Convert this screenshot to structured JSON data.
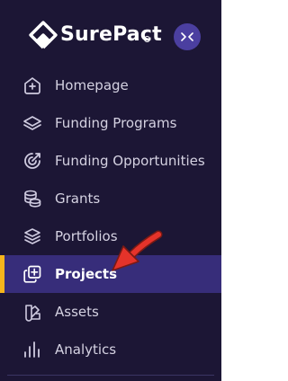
{
  "app": {
    "brand_name": "SurePact",
    "collapse_button_label": "><"
  },
  "colors": {
    "sidebar_bg": "#1c1635",
    "active_bg": "#372d7a",
    "active_marker": "#f6b51c",
    "collapse_bg": "#4b3fa0",
    "annotation_arrow": "#e5332a"
  },
  "nav": {
    "items": [
      {
        "label": "Homepage",
        "icon": "home-plus-icon"
      },
      {
        "label": "Funding Programs",
        "icon": "layers-icon"
      },
      {
        "label": "Funding Opportunities",
        "icon": "target-icon"
      },
      {
        "label": "Grants",
        "icon": "coin-stack-icon"
      },
      {
        "label": "Portfolios",
        "icon": "stacked-layers-icon"
      },
      {
        "label": "Projects",
        "icon": "copy-plus-icon",
        "active": true
      },
      {
        "label": "Assets",
        "icon": "shapes-icon"
      },
      {
        "label": "Analytics",
        "icon": "bar-chart-icon"
      }
    ]
  }
}
